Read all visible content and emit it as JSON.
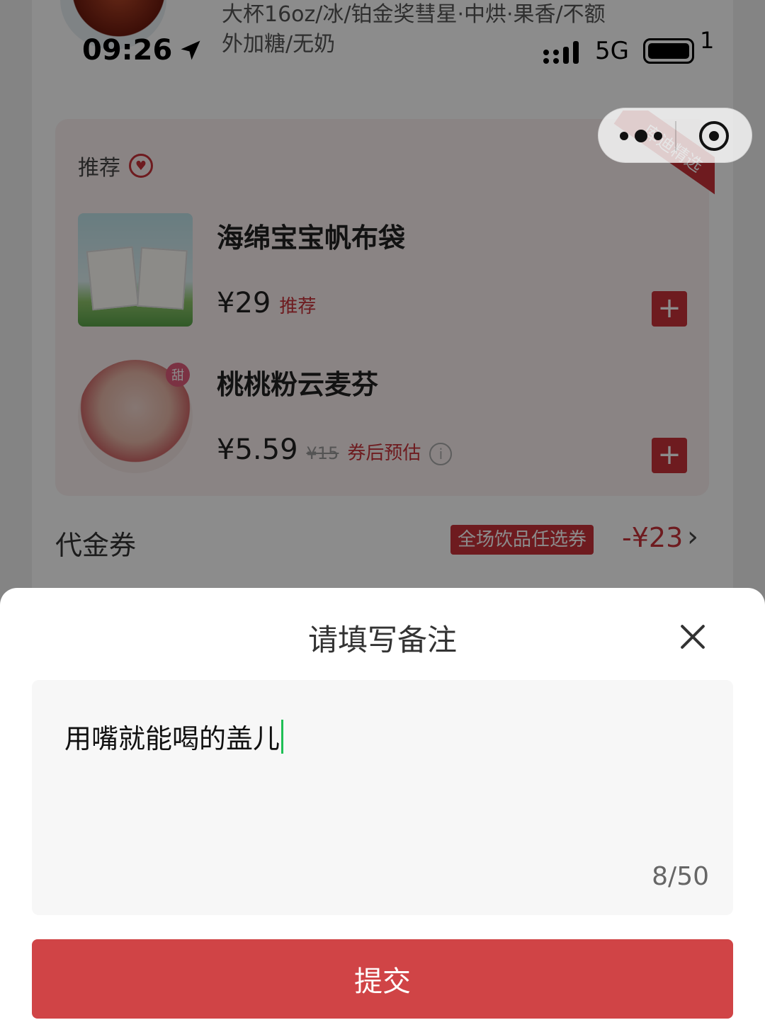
{
  "status_bar": {
    "time": "09:26",
    "network": "5G",
    "extra": "1"
  },
  "order": {
    "drink_spec_line1": "大杯16oz/冰/铂金奖彗星·中烘·果香/不额",
    "drink_spec_line2": "外加糖/无奶"
  },
  "recommend": {
    "title": "推荐",
    "ribbon": "库迪精选",
    "products": [
      {
        "name": "海绵宝宝帆布袋",
        "price": "¥29",
        "original_price": "",
        "tag": "推荐"
      },
      {
        "name": "桃桃粉云麦芬",
        "price": "¥5.59",
        "original_price": "¥15",
        "tag": "券后预估",
        "badge": "甜"
      }
    ]
  },
  "coupon": {
    "label": "代金券",
    "chip": "全场饮品任选券",
    "amount": "-¥23"
  },
  "sheet": {
    "title": "请填写备注",
    "note_value": "用嘴就能喝的盖儿",
    "char_count": "8/50",
    "submit_label": "提交"
  },
  "colors": {
    "brand_red": "#c8323a",
    "submit_red": "#d04446",
    "caret_green": "#1fbf55"
  }
}
